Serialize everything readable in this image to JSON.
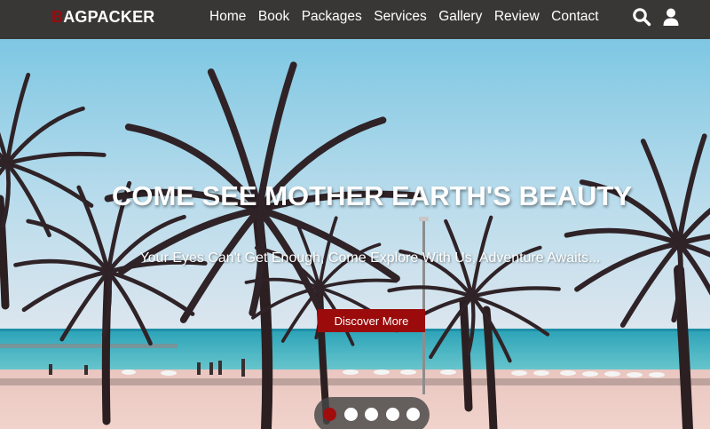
{
  "brand": {
    "first_letter": "B",
    "rest": "AGPACKER",
    "accent": "#9b0b0b"
  },
  "nav": {
    "links": [
      "Home",
      "Book",
      "Packages",
      "Services",
      "Gallery",
      "Review",
      "Contact"
    ],
    "icons": [
      "search-icon",
      "user-icon"
    ],
    "background": "#393636"
  },
  "hero": {
    "headline": "COME SEE MOTHER EARTH'S BEAUTY",
    "tagline": "Your Eyes Can't Get Enough, Come Explore With Us, Adventure Awaits...",
    "cta_label": "Discover More",
    "cta_color": "#9b0b0b",
    "background_image": "palm-trees-beach"
  },
  "slider": {
    "slide_count": 5,
    "active_index": 0,
    "active_color": "#a10d0d"
  }
}
